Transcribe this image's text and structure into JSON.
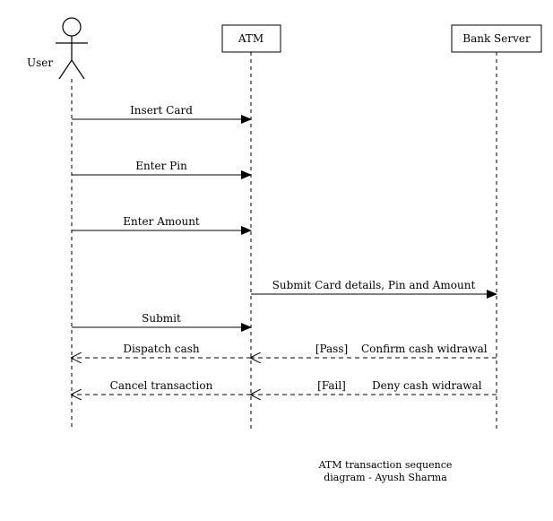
{
  "actors": {
    "user": "User",
    "atm": "ATM",
    "bank": "Bank Server"
  },
  "messages": {
    "m1": "Insert Card",
    "m2": "Enter Pin",
    "m3": "Enter Amount",
    "m4": "Submit Card details, Pin and Amount",
    "m5": "Submit",
    "m6_guard": "[Pass]",
    "m6_text": "Confirm cash widrawal",
    "m6_left": "Dispatch cash",
    "m7_guard": "[Fail]",
    "m7_text": "Deny cash widrawal",
    "m7_left": "Cancel transaction"
  },
  "caption": {
    "line1": "ATM transaction sequence",
    "line2": "diagram - Ayush Sharma"
  }
}
